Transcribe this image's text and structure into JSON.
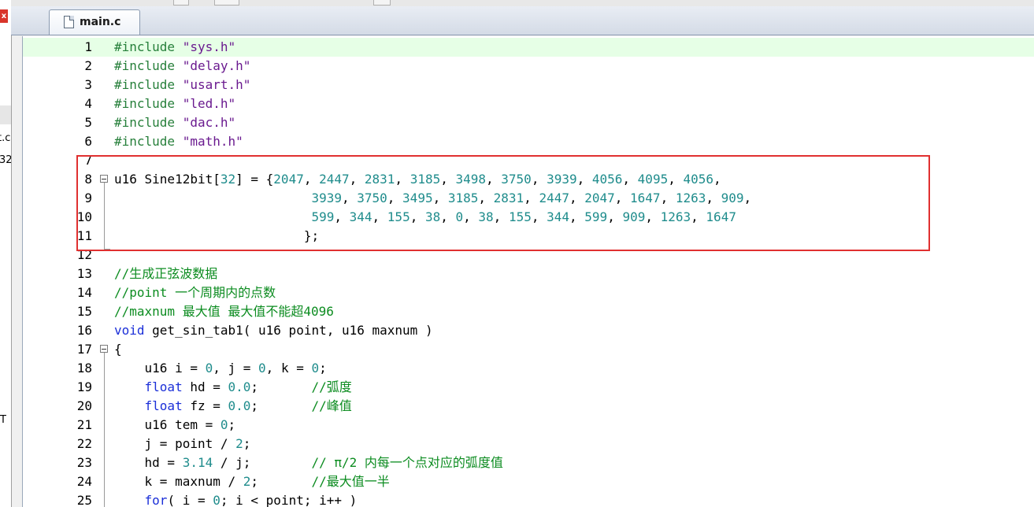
{
  "window": {
    "left_fragments": [
      "t.c",
      "32",
      "T"
    ],
    "close_glyph": "x"
  },
  "tab": {
    "label": "main.c",
    "icon": "file-icon"
  },
  "colors": {
    "preprocessor": "#267f3a",
    "string": "#6a1a8f",
    "number": "#1f8c8c",
    "keyword": "#1b2fd8",
    "comment": "#0c8c20",
    "highlight_box": "#e03030",
    "current_line": "#e6ffe6"
  },
  "editor": {
    "lines": [
      {
        "n": "1",
        "tokens": [
          [
            "pp",
            "#include "
          ],
          [
            "str",
            "\"sys.h\""
          ]
        ]
      },
      {
        "n": "2",
        "tokens": [
          [
            "pp",
            "#include "
          ],
          [
            "str",
            "\"delay.h\""
          ]
        ]
      },
      {
        "n": "3",
        "tokens": [
          [
            "pp",
            "#include "
          ],
          [
            "str",
            "\"usart.h\""
          ]
        ]
      },
      {
        "n": "4",
        "tokens": [
          [
            "pp",
            "#include "
          ],
          [
            "str",
            "\"led.h\""
          ]
        ]
      },
      {
        "n": "5",
        "tokens": [
          [
            "pp",
            "#include "
          ],
          [
            "str",
            "\"dac.h\""
          ]
        ]
      },
      {
        "n": "6",
        "tokens": [
          [
            "pp",
            "#include "
          ],
          [
            "str",
            "\"math.h\""
          ]
        ]
      },
      {
        "n": "7",
        "tokens": []
      },
      {
        "n": "8",
        "tokens": [
          [
            "",
            "u16 Sine12bit["
          ],
          [
            "num",
            "32"
          ],
          [
            "",
            "] = {"
          ],
          [
            "num",
            "2047"
          ],
          [
            "",
            ", "
          ],
          [
            "num",
            "2447"
          ],
          [
            "",
            ", "
          ],
          [
            "num",
            "2831"
          ],
          [
            "",
            ", "
          ],
          [
            "num",
            "3185"
          ],
          [
            "",
            ", "
          ],
          [
            "num",
            "3498"
          ],
          [
            "",
            ", "
          ],
          [
            "num",
            "3750"
          ],
          [
            "",
            ", "
          ],
          [
            "num",
            "3939"
          ],
          [
            "",
            ", "
          ],
          [
            "num",
            "4056"
          ],
          [
            "",
            ", "
          ],
          [
            "num",
            "4095"
          ],
          [
            "",
            ", "
          ],
          [
            "num",
            "4056"
          ],
          [
            "",
            ","
          ]
        ]
      },
      {
        "n": "9",
        "tokens": [
          [
            "",
            "                          "
          ],
          [
            "num",
            "3939"
          ],
          [
            "",
            ", "
          ],
          [
            "num",
            "3750"
          ],
          [
            "",
            ", "
          ],
          [
            "num",
            "3495"
          ],
          [
            "",
            ", "
          ],
          [
            "num",
            "3185"
          ],
          [
            "",
            ", "
          ],
          [
            "num",
            "2831"
          ],
          [
            "",
            ", "
          ],
          [
            "num",
            "2447"
          ],
          [
            "",
            ", "
          ],
          [
            "num",
            "2047"
          ],
          [
            "",
            ", "
          ],
          [
            "num",
            "1647"
          ],
          [
            "",
            ", "
          ],
          [
            "num",
            "1263"
          ],
          [
            "",
            ", "
          ],
          [
            "num",
            "909"
          ],
          [
            "",
            ","
          ]
        ]
      },
      {
        "n": "10",
        "tokens": [
          [
            "",
            "                          "
          ],
          [
            "num",
            "599"
          ],
          [
            "",
            ", "
          ],
          [
            "num",
            "344"
          ],
          [
            "",
            ", "
          ],
          [
            "num",
            "155"
          ],
          [
            "",
            ", "
          ],
          [
            "num",
            "38"
          ],
          [
            "",
            ", "
          ],
          [
            "num",
            "0"
          ],
          [
            "",
            ", "
          ],
          [
            "num",
            "38"
          ],
          [
            "",
            ", "
          ],
          [
            "num",
            "155"
          ],
          [
            "",
            ", "
          ],
          [
            "num",
            "344"
          ],
          [
            "",
            ", "
          ],
          [
            "num",
            "599"
          ],
          [
            "",
            ", "
          ],
          [
            "num",
            "909"
          ],
          [
            "",
            ", "
          ],
          [
            "num",
            "1263"
          ],
          [
            "",
            ", "
          ],
          [
            "num",
            "1647"
          ]
        ]
      },
      {
        "n": "11",
        "tokens": [
          [
            "",
            "                         };"
          ]
        ]
      },
      {
        "n": "12",
        "tokens": []
      },
      {
        "n": "13",
        "tokens": [
          [
            "cm",
            "//生成正弦波数据"
          ]
        ]
      },
      {
        "n": "14",
        "tokens": [
          [
            "cm",
            "//point 一个周期内的点数"
          ]
        ]
      },
      {
        "n": "15",
        "tokens": [
          [
            "cm",
            "//maxnum 最大值 最大值不能超4096"
          ]
        ]
      },
      {
        "n": "16",
        "tokens": [
          [
            "kw",
            "void"
          ],
          [
            "",
            " get_sin_tab1( u16 point, u16 maxnum )"
          ]
        ]
      },
      {
        "n": "17",
        "tokens": [
          [
            "",
            "{"
          ]
        ]
      },
      {
        "n": "18",
        "tokens": [
          [
            "",
            "    u16 i = "
          ],
          [
            "num",
            "0"
          ],
          [
            "",
            ", j = "
          ],
          [
            "num",
            "0"
          ],
          [
            "",
            ", k = "
          ],
          [
            "num",
            "0"
          ],
          [
            "",
            ";"
          ]
        ]
      },
      {
        "n": "19",
        "tokens": [
          [
            "",
            "    "
          ],
          [
            "kw",
            "float"
          ],
          [
            "",
            " hd = "
          ],
          [
            "num",
            "0.0"
          ],
          [
            "",
            ";       "
          ],
          [
            "cm",
            "//弧度"
          ]
        ]
      },
      {
        "n": "20",
        "tokens": [
          [
            "",
            "    "
          ],
          [
            "kw",
            "float"
          ],
          [
            "",
            " fz = "
          ],
          [
            "num",
            "0.0"
          ],
          [
            "",
            ";       "
          ],
          [
            "cm",
            "//峰值"
          ]
        ]
      },
      {
        "n": "21",
        "tokens": [
          [
            "",
            "    u16 tem = "
          ],
          [
            "num",
            "0"
          ],
          [
            "",
            ";"
          ]
        ]
      },
      {
        "n": "22",
        "tokens": [
          [
            "",
            "    j = point / "
          ],
          [
            "num",
            "2"
          ],
          [
            "",
            ";"
          ]
        ]
      },
      {
        "n": "23",
        "tokens": [
          [
            "",
            "    hd = "
          ],
          [
            "num",
            "3.14"
          ],
          [
            "",
            " / j;        "
          ],
          [
            "cm",
            "// π/2 内每一个点对应的弧度值"
          ]
        ]
      },
      {
        "n": "24",
        "tokens": [
          [
            "",
            "    k = maxnum / "
          ],
          [
            "num",
            "2"
          ],
          [
            "",
            ";       "
          ],
          [
            "cm",
            "//最大值一半"
          ]
        ]
      },
      {
        "n": "25",
        "tokens": [
          [
            "",
            "    "
          ],
          [
            "kw",
            "for"
          ],
          [
            "",
            "( i = "
          ],
          [
            "num",
            "0"
          ],
          [
            "",
            "; i < point; i++ )"
          ]
        ]
      }
    ]
  }
}
